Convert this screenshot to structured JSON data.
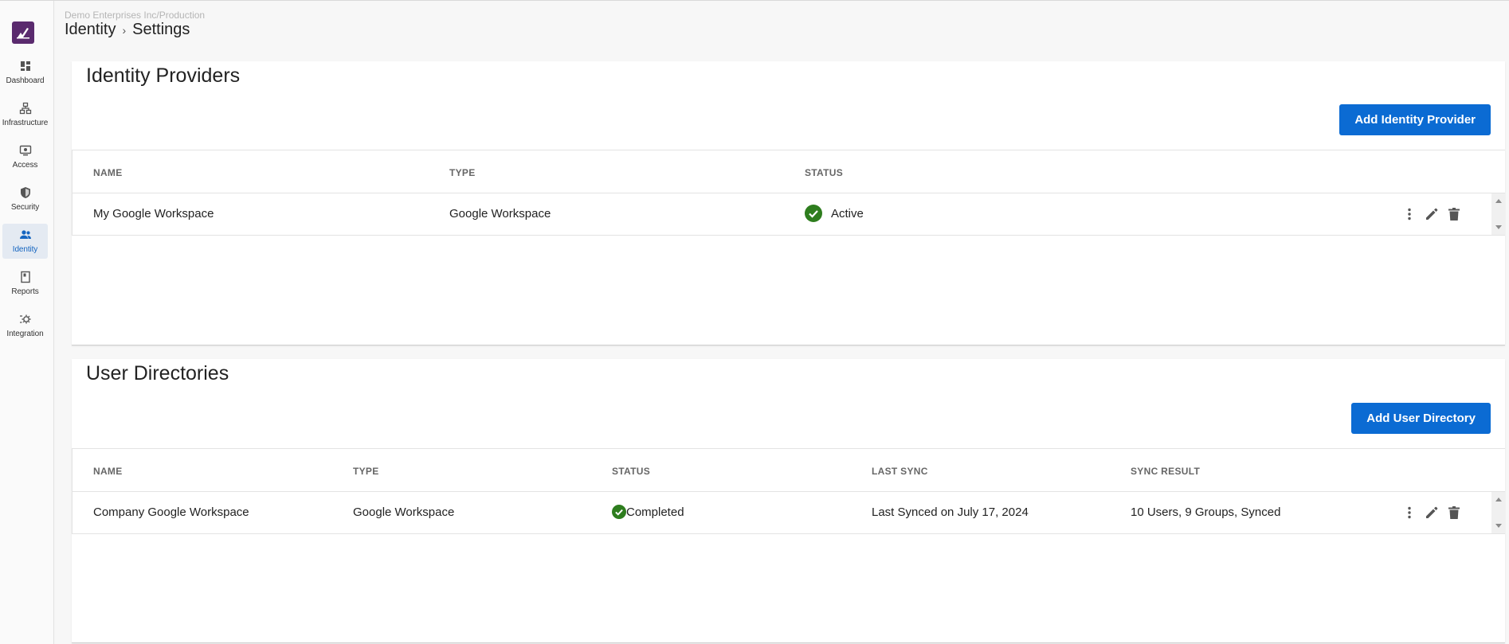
{
  "header": {
    "org_path": "Demo Enterprises Inc/Production",
    "breadcrumb": [
      "Identity",
      "Settings"
    ],
    "separator": "›"
  },
  "sidebar": {
    "items": [
      {
        "label": "Dashboard",
        "icon": "dashboard-icon",
        "active": false
      },
      {
        "label": "Infrastructure",
        "icon": "sitemap-icon",
        "active": false
      },
      {
        "label": "Access",
        "icon": "monitor-icon",
        "active": false
      },
      {
        "label": "Security",
        "icon": "shield-icon",
        "active": false
      },
      {
        "label": "Identity",
        "icon": "users-icon",
        "active": true
      },
      {
        "label": "Reports",
        "icon": "report-icon",
        "active": false
      },
      {
        "label": "Integration",
        "icon": "gear-link-icon",
        "active": false
      }
    ]
  },
  "identity_providers": {
    "title": "Identity Providers",
    "add_button": "Add Identity Provider",
    "columns": [
      "NAME",
      "TYPE",
      "STATUS"
    ],
    "rows": [
      {
        "name": "My Google Workspace",
        "type": "Google Workspace",
        "status": "Active"
      }
    ]
  },
  "user_directories": {
    "title": "User Directories",
    "add_button": "Add User Directory",
    "columns": [
      "NAME",
      "TYPE",
      "STATUS",
      "LAST SYNC",
      "SYNC RESULT"
    ],
    "rows": [
      {
        "name": "Company Google Workspace",
        "type": "Google Workspace",
        "status": "Completed",
        "last_sync": "Last Synced on July 17, 2024",
        "sync_result": "10 Users, 9 Groups, Synced"
      }
    ]
  },
  "colors": {
    "accent": "#0b6bd3",
    "status_ok": "#2e7d1e",
    "logo": "#5a2a6e",
    "active_nav_bg": "#e4eaf2"
  }
}
